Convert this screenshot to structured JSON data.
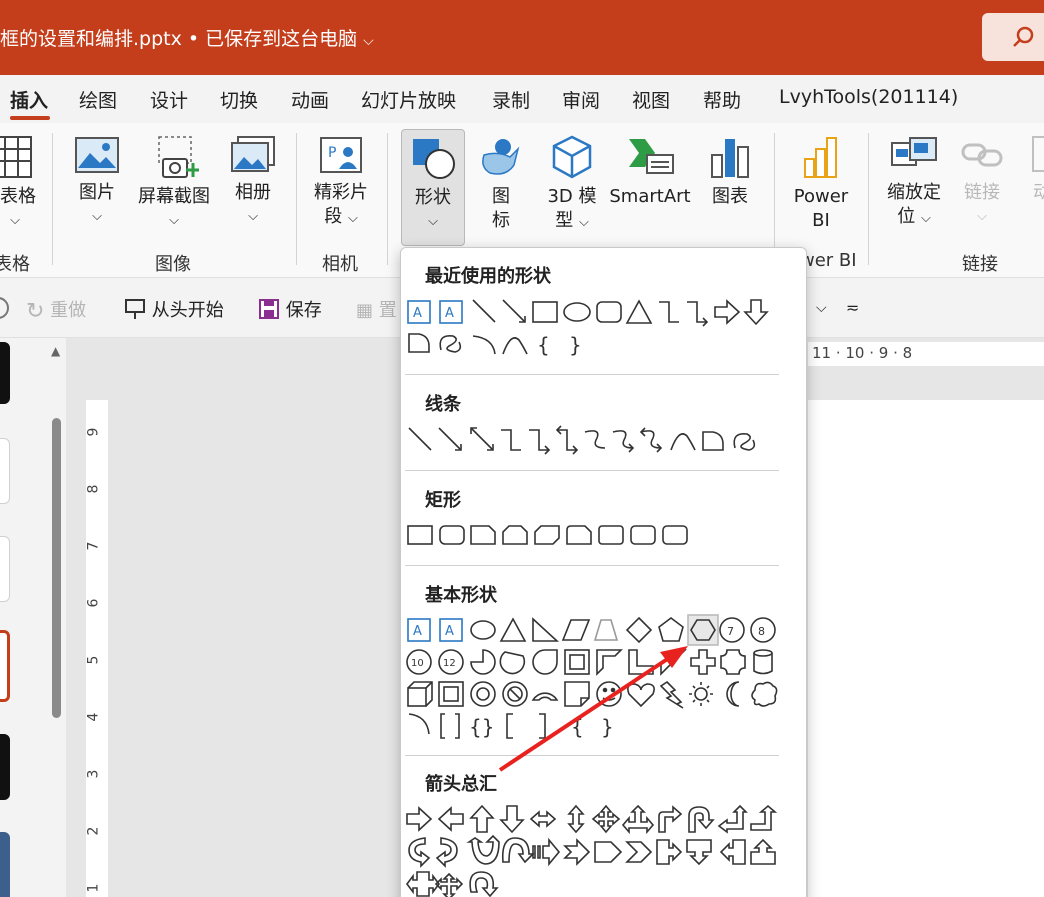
{
  "window": {
    "title": "框的设置和编排.pptx • 已保存到这台电脑"
  },
  "tabs": [
    "插入",
    "绘图",
    "设计",
    "切换",
    "动画",
    "幻灯片放映",
    "录制",
    "审阅",
    "视图",
    "帮助",
    "LvyhTools(201114)"
  ],
  "active_tab": "插入",
  "ribbon": {
    "table_label": "表格",
    "table_group": "表格",
    "picture_label": "图片",
    "screenshot_label": "屏幕截图",
    "album_label": "相册",
    "images_group": "图像",
    "highlight_line1": "精彩片",
    "highlight_line2": "段",
    "camera_group": "相机",
    "shapes_label": "形状",
    "icons_line1": "图",
    "icons_line2": "标",
    "model3d_line1": "3D 模",
    "model3d_line2": "型",
    "smartart_label": "SmartArt",
    "chart_label": "图表",
    "powerbi_line1": "Power",
    "powerbi_line2": "BI",
    "powerbi_group": "wer BI",
    "zoom_line1": "缩放定",
    "zoom_line2": "位",
    "link_label": "链接",
    "links_group": "链接",
    "action_label": "动"
  },
  "quick_access": {
    "redo": "重做",
    "from_start": "从头开始",
    "save": "保存",
    "align_partial": "置"
  },
  "ruler": {
    "h_marks": "11 · 10 · 9 · 8",
    "v_marks": [
      "9",
      "8",
      "7",
      "6",
      "5",
      "4",
      "3",
      "2",
      "1"
    ]
  },
  "shapes_menu": {
    "recent": "最近使用的形状",
    "lines": "线条",
    "rectangles": "矩形",
    "basic": "基本形状",
    "arrows": "箭头总汇"
  },
  "colors": {
    "accent": "#c43e1c",
    "selected_shape_border": "#2b78c5"
  }
}
